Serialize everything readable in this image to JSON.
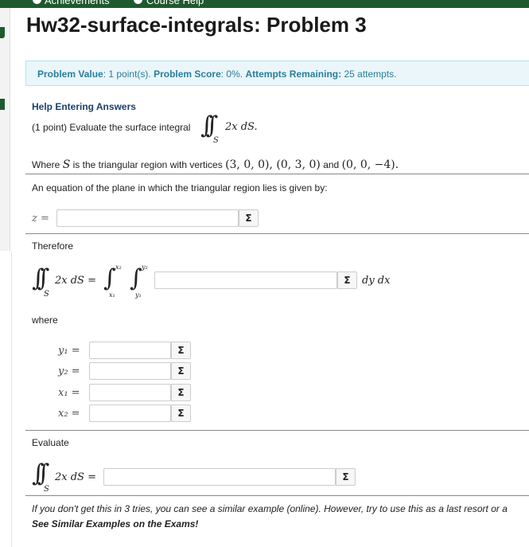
{
  "nav": {
    "achievements": "Achievements",
    "course_help": "Course Help"
  },
  "title": "Hw32-surface-integrals: Problem 3",
  "info": {
    "value_label": "Problem Value",
    "value_text": ": 1 point(s). ",
    "score_label": "Problem Score",
    "score_text": ": 0%. ",
    "attempts_label": "Attempts Remaining:",
    "attempts_text": " 25 attempts."
  },
  "help_link": "Help Entering Answers",
  "prompt": "(1 point) Evaluate the surface integral",
  "integrand": "2x dS.",
  "region_text_1": "Where",
  "region_S": "S",
  "region_text_2": "is the triangular region with vertices",
  "vertices": "(3, 0, 0), (0, 3, 0)",
  "vertices_and": "and",
  "vertex_last": "(0, 0, −4).",
  "plane_text": "An equation of the plane in which the triangular region lies is given by:",
  "z_label": "z =",
  "therefore": "Therefore",
  "integrand_eq": "2x dS =",
  "dydx": "dy dx",
  "where": "where",
  "labels": {
    "y1": "y₁ =",
    "y2": "y₂ =",
    "x1": "x₁ =",
    "x2": "x₂ =",
    "x2_sup": "x₂",
    "y2_sup": "y₂",
    "x1_sub": "x₁",
    "y1_sub": "y₁"
  },
  "evaluate": "Evaluate",
  "integrand_final": "2x dS =",
  "sigma": "Σ",
  "footer_italic": "If you don't get this in 3 tries, you can see a similar example (online). However, try to use this as a last resort or a",
  "footer_bold": "See Similar Examples on the Exams!"
}
